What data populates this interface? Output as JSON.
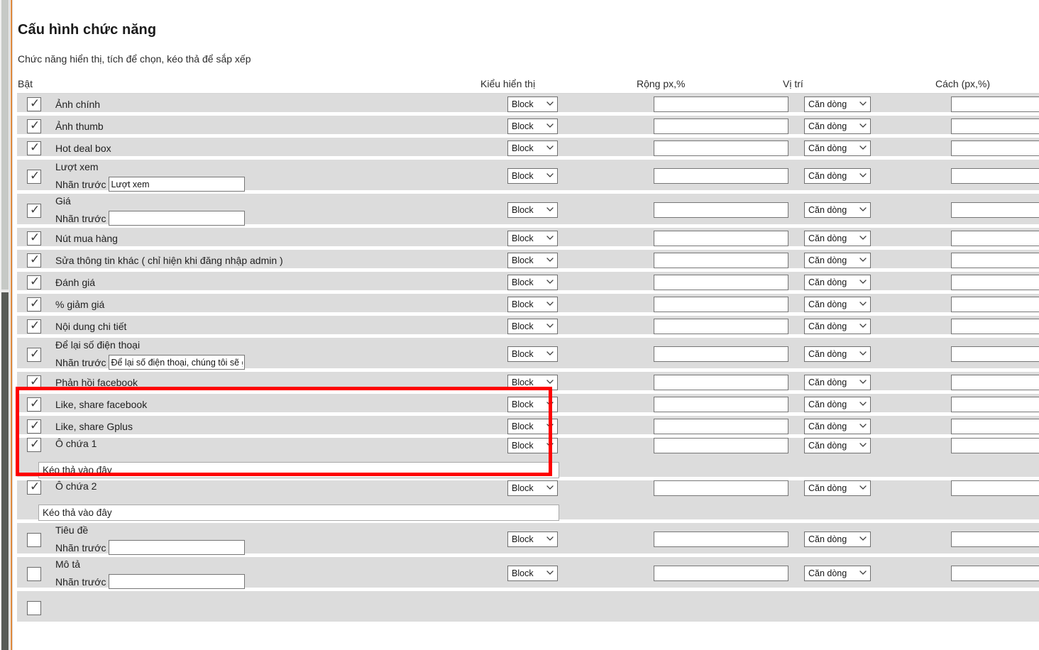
{
  "page": {
    "title": "Cấu hình chức năng",
    "subtitle": "Chức năng hiển thị, tích để chọn, kéo thả để sắp xếp"
  },
  "columns": {
    "enable": "Bật",
    "display_type": "Kiểu hiển thị",
    "width": "Rộng px,%",
    "position": "Vị trí",
    "spacing": "Cách (px,%)"
  },
  "labels": {
    "prefix": "Nhãn trước",
    "dropzone": "Kéo thả vào đây",
    "check_glyph": "✓"
  },
  "defaults": {
    "display_type": "Block",
    "position": "Căn dòng",
    "width_value": "",
    "spacing_value": ""
  },
  "highlight_color": "#fe0000",
  "rows": [
    {
      "name": "Ảnh chính",
      "checked": true,
      "prefix": null,
      "display": "Block",
      "width": "",
      "position": "Căn dòng",
      "spacing": ""
    },
    {
      "name": "Ảnh thumb",
      "checked": true,
      "prefix": null,
      "display": "Block",
      "width": "",
      "position": "Căn dòng",
      "spacing": ""
    },
    {
      "name": "Hot deal box",
      "checked": true,
      "prefix": null,
      "display": "Block",
      "width": "",
      "position": "Căn dòng",
      "spacing": ""
    },
    {
      "name": "Lượt xem",
      "checked": true,
      "prefix": "Lượt xem",
      "display": "Block",
      "width": "",
      "position": "Căn dòng",
      "spacing": ""
    },
    {
      "name": "Giá",
      "checked": true,
      "prefix": "",
      "display": "Block",
      "width": "",
      "position": "Căn dòng",
      "spacing": ""
    },
    {
      "name": "Nút mua hàng",
      "checked": true,
      "prefix": null,
      "display": "Block",
      "width": "",
      "position": "Căn dòng",
      "spacing": ""
    },
    {
      "name": "Sửa thông tin khác ( chỉ hiện khi đăng nhập admin )",
      "checked": true,
      "prefix": null,
      "display": "Block",
      "width": "",
      "position": "Căn dòng",
      "spacing": ""
    },
    {
      "name": "Đánh giá",
      "checked": true,
      "prefix": null,
      "display": "Block",
      "width": "",
      "position": "Căn dòng",
      "spacing": ""
    },
    {
      "name": "% giảm giá",
      "checked": true,
      "prefix": null,
      "display": "Block",
      "width": "",
      "position": "Căn dòng",
      "spacing": ""
    },
    {
      "name": "Nội dung chi tiết",
      "checked": true,
      "prefix": null,
      "display": "Block",
      "width": "",
      "position": "Căn dòng",
      "spacing": ""
    },
    {
      "name": "Để lại số điện thoại",
      "checked": true,
      "prefix": "Để lại số điện thoại, chúng tôi sẽ gọi lại",
      "display": "Block",
      "width": "",
      "position": "Căn dòng",
      "spacing": ""
    },
    {
      "name": "Phản hồi facebook",
      "checked": true,
      "prefix": null,
      "display": "Block",
      "width": "",
      "position": "Căn dòng",
      "spacing": ""
    },
    {
      "name": "Like, share facebook",
      "checked": true,
      "prefix": null,
      "display": "Block",
      "width": "",
      "position": "Căn dòng",
      "spacing": ""
    },
    {
      "name": "Like, share Gplus",
      "checked": true,
      "prefix": null,
      "display": "Block",
      "width": "",
      "position": "Căn dòng",
      "spacing": ""
    },
    {
      "name": "Ô chứa 1",
      "checked": true,
      "prefix": null,
      "display": "Block",
      "width": "",
      "position": "Căn dòng",
      "spacing": "",
      "dropzone": "Kéo thả vào đây",
      "highlighted": true
    },
    {
      "name": "Ô chứa 2",
      "checked": true,
      "prefix": null,
      "display": "Block",
      "width": "",
      "position": "Căn dòng",
      "spacing": "",
      "dropzone": "Kéo thả vào đây",
      "highlighted": true
    },
    {
      "name": "Tiêu đề",
      "checked": false,
      "prefix": "",
      "display": "Block",
      "width": "",
      "position": "Căn dòng",
      "spacing": ""
    },
    {
      "name": "Mô tả",
      "checked": false,
      "prefix": "",
      "display": "Block",
      "width": "",
      "position": "Căn dòng",
      "spacing": ""
    }
  ]
}
